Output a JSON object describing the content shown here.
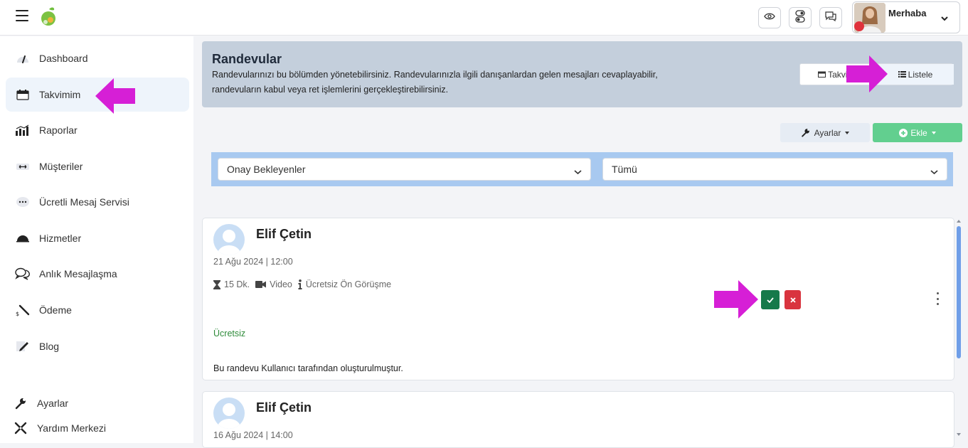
{
  "topbar": {
    "profile_greeting": "Merhaba",
    "icons": [
      "menu-icon",
      "eye-icon",
      "toggle-icon",
      "chat-icon",
      "chevron-down-icon"
    ]
  },
  "sidebar": {
    "items": [
      {
        "label": "Dashboard",
        "icon": "dashboard-icon",
        "active": false
      },
      {
        "label": "Takvimim",
        "icon": "calendar-icon",
        "active": true
      },
      {
        "label": "Raporlar",
        "icon": "bar-chart-icon",
        "active": false
      },
      {
        "label": "Müşteriler",
        "icon": "customers-icon",
        "active": false
      },
      {
        "label": "Ücretli Mesaj Servisi",
        "icon": "message-dots-icon",
        "active": false
      },
      {
        "label": "Hizmetler",
        "icon": "services-icon",
        "active": false
      },
      {
        "label": "Anlık Mesajlaşma",
        "icon": "chat-bubbles-icon",
        "active": false
      },
      {
        "label": "Ödeme",
        "icon": "payment-icon",
        "active": false
      },
      {
        "label": "Blog",
        "icon": "pen-icon",
        "active": false
      }
    ],
    "bottom": [
      {
        "label": "Ayarlar",
        "icon": "wrench-icon"
      },
      {
        "label": "Yardım Merkezi",
        "icon": "help-icon"
      }
    ]
  },
  "header": {
    "title": "Randevular",
    "description": "Randevularınızı bu bölümden yönetebilirsiniz. Randevularınızla ilgili danışanlardan gelen mesajları cevaplayabilir, randevuların kabul veya ret işlemlerini gerçekleştirebilirsiniz.",
    "view_calendar": "Takvim",
    "view_list": "Listele"
  },
  "toolbar": {
    "settings_label": "Ayarlar",
    "add_label": "Ekle"
  },
  "filters": {
    "status": "Onay Bekleyenler",
    "type": "Tümü"
  },
  "appointments": [
    {
      "name": "Elif Çetin",
      "date": "21 Ağu 2024 | 12:00",
      "duration": "15 Dk.",
      "mode": "Video",
      "service": "Ücretsiz Ön Görüşme",
      "price": "Ücretsiz",
      "note": "Bu randevu Kullanıcı tarafından oluşturulmuştur."
    },
    {
      "name": "Elif Çetin",
      "date": "16 Ağu 2024 | 14:00"
    }
  ],
  "colors": {
    "accent_arrow": "#d61fd6",
    "accept": "#16794a",
    "reject": "#d9343f",
    "add_button": "#62cf8f",
    "header_bg": "#c4cfdc",
    "filter_band": "#a8c9f0"
  }
}
